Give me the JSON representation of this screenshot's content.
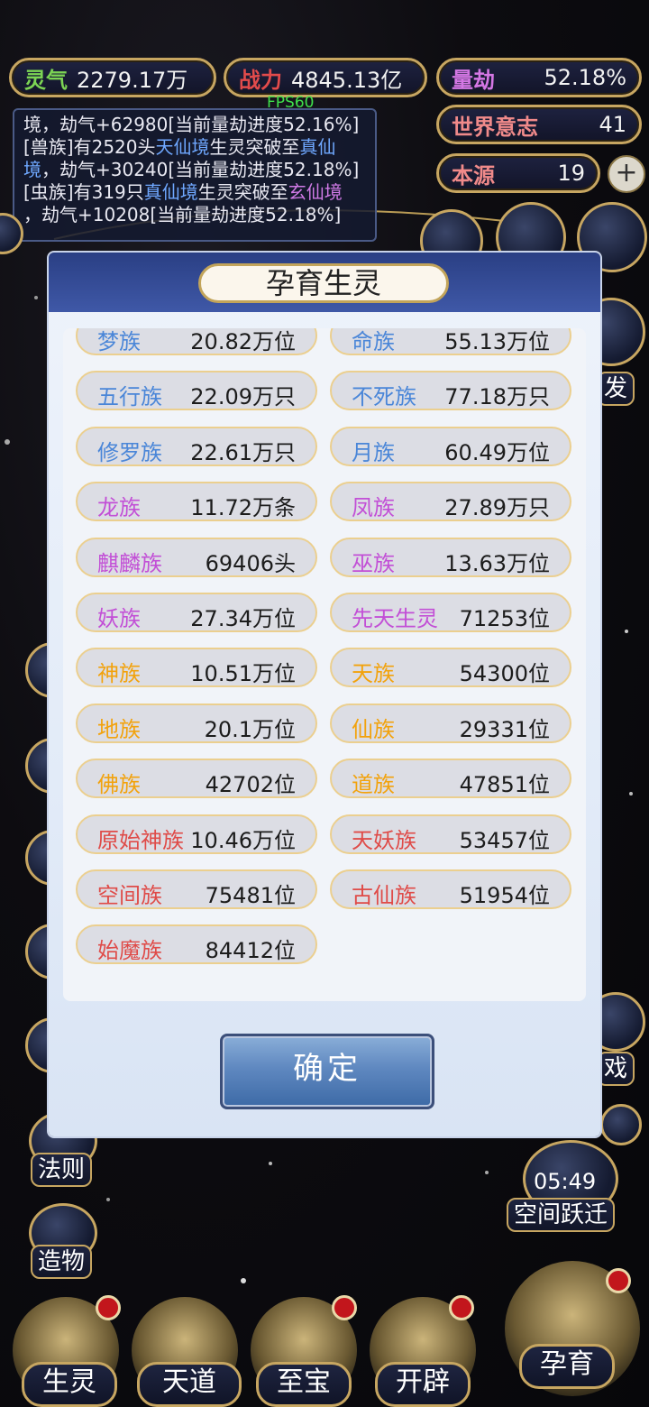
{
  "hud": {
    "lingqi_label": "灵气",
    "lingqi_value": "2279.17万",
    "zhanli_label": "战力",
    "zhanli_value": "4845.13亿",
    "liangjie_label": "量劫",
    "liangjie_value": "52.18%",
    "world_will_label": "世界意志",
    "world_will_value": "41",
    "origin_label": "本源",
    "origin_value": "19",
    "fps": "FPS60"
  },
  "log": {
    "line1_text": "境，劫气+62980[当前量劫进度52.16%]",
    "line2_a": "[兽族]有2520头",
    "line2_realm": "天仙境",
    "line2_b": "生灵突破至",
    "line2_target": "真仙",
    "line3_target": "境",
    "line3_b": "，劫气+30240[当前量劫进度52.18%]",
    "line4_a": "[虫族]有319只",
    "line4_realm": "真仙境",
    "line4_b": "生灵突破至",
    "line4_target": "玄仙境",
    "line5": "，劫气+10208[当前量劫进度52.18%]"
  },
  "side": {
    "fa_ze": "法则",
    "zao_wu": "造物",
    "timer": "05:49",
    "space_jump": "空间跃迁",
    "right_partial_1": "发",
    "right_partial_2": "戏"
  },
  "bottom_nav": [
    "生灵",
    "天道",
    "至宝",
    "开辟",
    "孕育"
  ],
  "modal": {
    "title": "孕育生灵",
    "confirm": "确定",
    "colors": {
      "blue": "#4a86d8",
      "purple": "#c24fd6",
      "orange": "#f2a20c",
      "red": "#df4b48"
    },
    "races": [
      {
        "name": "梦族",
        "count": "20.82万位",
        "color": "blue"
      },
      {
        "name": "命族",
        "count": "55.13万位",
        "color": "blue"
      },
      {
        "name": "五行族",
        "count": "22.09万只",
        "color": "blue"
      },
      {
        "name": "不死族",
        "count": "77.18万只",
        "color": "blue"
      },
      {
        "name": "修罗族",
        "count": "22.61万只",
        "color": "blue"
      },
      {
        "name": "月族",
        "count": "60.49万位",
        "color": "blue"
      },
      {
        "name": "龙族",
        "count": "11.72万条",
        "color": "purple"
      },
      {
        "name": "凤族",
        "count": "27.89万只",
        "color": "purple"
      },
      {
        "name": "麒麟族",
        "count": "69406头",
        "color": "purple"
      },
      {
        "name": "巫族",
        "count": "13.63万位",
        "color": "purple"
      },
      {
        "name": "妖族",
        "count": "27.34万位",
        "color": "purple"
      },
      {
        "name": "先天生灵",
        "count": "71253位",
        "color": "purple"
      },
      {
        "name": "神族",
        "count": "10.51万位",
        "color": "orange"
      },
      {
        "name": "天族",
        "count": "54300位",
        "color": "orange"
      },
      {
        "name": "地族",
        "count": "20.1万位",
        "color": "orange"
      },
      {
        "name": "仙族",
        "count": "29331位",
        "color": "orange"
      },
      {
        "name": "佛族",
        "count": "42702位",
        "color": "orange"
      },
      {
        "name": "道族",
        "count": "47851位",
        "color": "orange"
      },
      {
        "name": "原始神族",
        "count": "10.46万位",
        "color": "red"
      },
      {
        "name": "天妖族",
        "count": "53457位",
        "color": "red"
      },
      {
        "name": "空间族",
        "count": "75481位",
        "color": "red"
      },
      {
        "name": "古仙族",
        "count": "51954位",
        "color": "red"
      },
      {
        "name": "始魔族",
        "count": "84412位",
        "color": "red"
      }
    ]
  }
}
